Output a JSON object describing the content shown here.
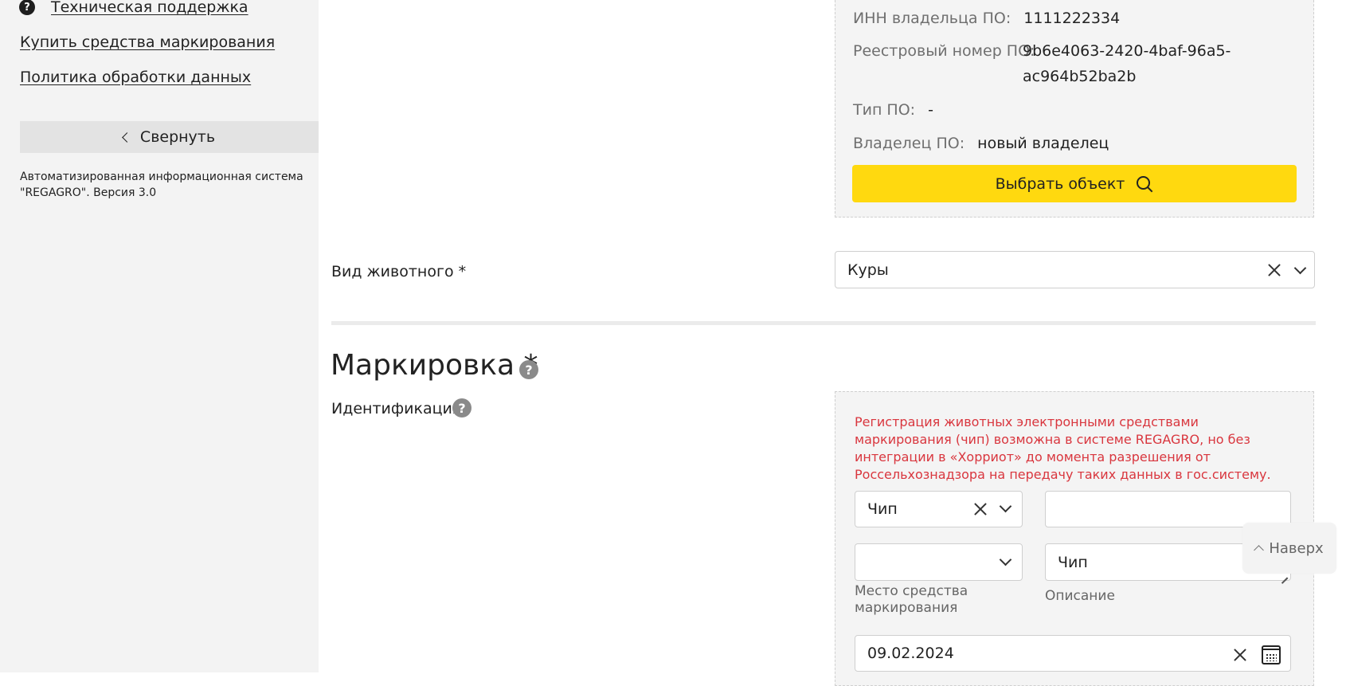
{
  "sidebar": {
    "support_label": "Техническая поддержка",
    "support_icon_glyph": "?",
    "buy_label": "Купить средства маркирования",
    "policy_label": "Политика обработки данных",
    "collapse_label": "Свернуть",
    "footer_text": "Автоматизированная информационная система \"REGAGRO\". Версия 3.0"
  },
  "object_panel": {
    "inn_label": "ИНН владельца ПО:",
    "inn_value": "1111222334",
    "registry_label": "Реестровый номер ПО:",
    "registry_value_line1": "9b6e4063-2420-4baf-96a5-",
    "registry_value_line2": "ac964b52ba2b",
    "type_label": "Тип ПО:",
    "type_value": "-",
    "owner_label": "Владелец ПО:",
    "owner_value": "новый владелец",
    "select_button_label": "Выбрать объект",
    "select_button_color": "#ffd90f"
  },
  "animal": {
    "label": "Вид животного *",
    "value": "Куры"
  },
  "marking": {
    "title": "Маркировка *",
    "help_glyph": "?",
    "identification_label": "Идентификация",
    "warning_text": "Регистрация животных электронными средствами маркирования (чип) возможна в системе REGAGRO, но без интеграции в «Хорриот» до момента разрешения от Россельхознадзора на передачу таких данных в гос.систему.",
    "warning_color": "#d9363e",
    "type_value": "Чип",
    "number_value": "",
    "place_value": "",
    "place_caption": "Место средства маркирования",
    "description_value": "Чип",
    "description_caption": "Описание",
    "date_value": "09.02.2024"
  },
  "to_top_label": "Наверх"
}
